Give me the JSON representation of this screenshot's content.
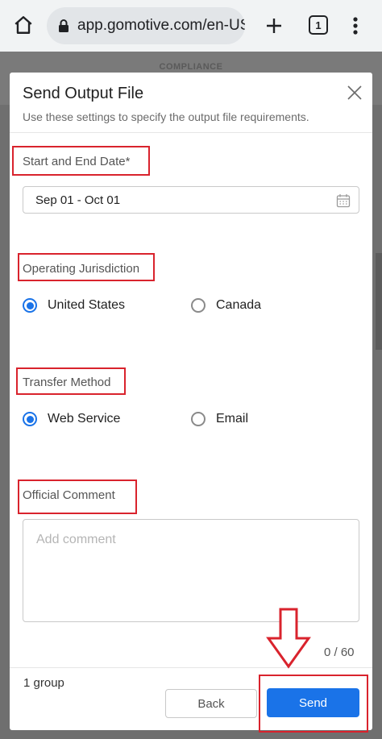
{
  "browser": {
    "url": "app.gomotive.com/en-US",
    "tab_count": "1"
  },
  "background_page": {
    "title": "COMPLIANCE"
  },
  "modal": {
    "title": "Send Output File",
    "subtitle": "Use these settings to specify the output file requirements.",
    "date_section": {
      "label": "Start and End Date*",
      "value": "Sep 01 - Oct 01"
    },
    "jurisdiction_section": {
      "label": "Operating Jurisdiction",
      "options": [
        {
          "label": "United States",
          "selected": true
        },
        {
          "label": "Canada",
          "selected": false
        }
      ]
    },
    "transfer_section": {
      "label": "Transfer Method",
      "options": [
        {
          "label": "Web Service",
          "selected": true
        },
        {
          "label": "Email",
          "selected": false
        }
      ]
    },
    "comment_section": {
      "label": "Official Comment",
      "placeholder": "Add comment",
      "counter": "0 / 60"
    },
    "footer": {
      "group_text": "1 group",
      "back_label": "Back",
      "send_label": "Send"
    }
  },
  "colors": {
    "accent": "#1a73e8",
    "annotation_red": "#d9232d"
  }
}
